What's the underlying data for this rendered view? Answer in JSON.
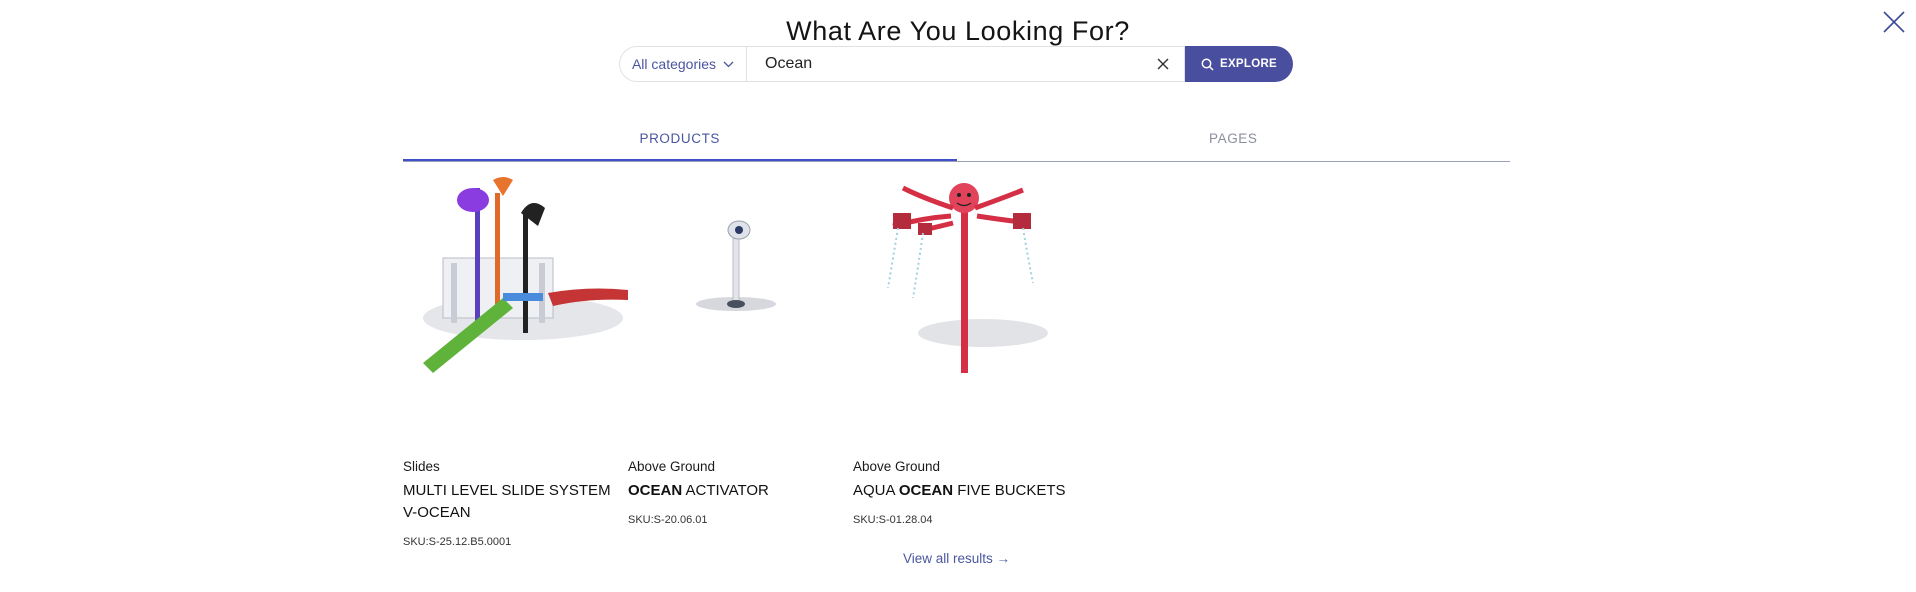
{
  "header": {
    "title": "What Are You Looking For?"
  },
  "search": {
    "category_label": "All categories",
    "query": "Ocean",
    "explore_label": "EXPLORE"
  },
  "tabs": [
    {
      "label": "PRODUCTS",
      "active": true
    },
    {
      "label": "PAGES",
      "active": false
    }
  ],
  "products": [
    {
      "category": "Slides",
      "name_prefix": "MULTI LEVEL SLIDE SYSTEM V-",
      "name_match": "",
      "name_suffix": "OCEAN",
      "sku": "SKU:S-25.12.B5.0001",
      "image_icon": "slide-system-image"
    },
    {
      "category": "Above Ground",
      "name_prefix": "",
      "name_match": "OCEAN",
      "name_suffix": " ACTIVATOR",
      "sku": "SKU:S-20.06.01",
      "image_icon": "activator-image"
    },
    {
      "category": "Above Ground",
      "name_prefix": "AQUA ",
      "name_match": "OCEAN",
      "name_suffix": " FIVE BUCKETS",
      "sku": "SKU:S-01.28.04",
      "image_icon": "octopus-buckets-image"
    }
  ],
  "footer": {
    "view_all_label": "View all results →"
  },
  "colors": {
    "accent": "#4a4e9e",
    "link": "#4a56a0",
    "tab_underline": "#3f4fc9"
  }
}
